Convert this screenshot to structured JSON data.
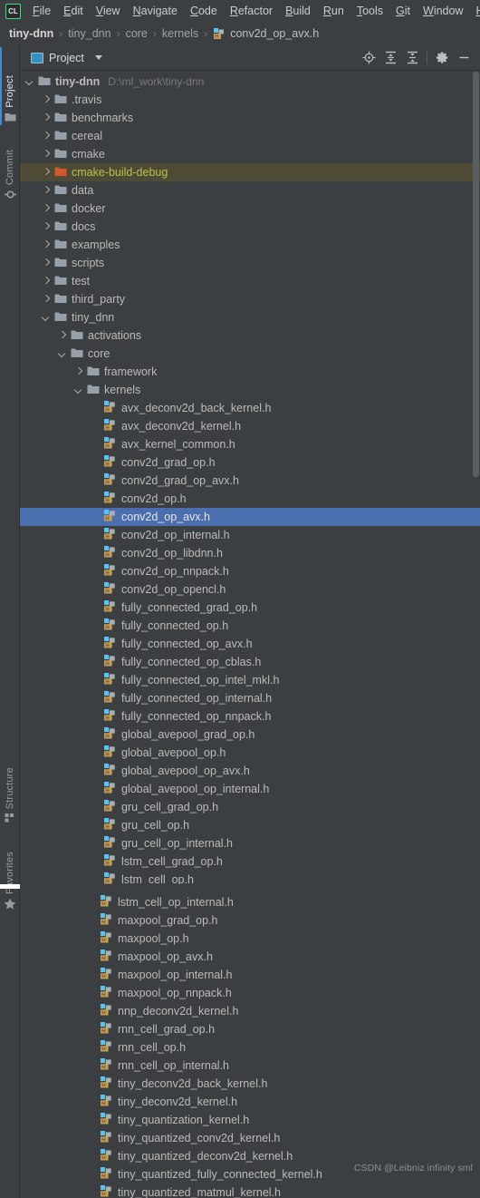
{
  "app": {
    "logo_text": "CL",
    "menu": [
      {
        "label": "File",
        "mnemonic": "F"
      },
      {
        "label": "Edit",
        "mnemonic": "E"
      },
      {
        "label": "View",
        "mnemonic": "V"
      },
      {
        "label": "Navigate",
        "mnemonic": "N"
      },
      {
        "label": "Code",
        "mnemonic": "C"
      },
      {
        "label": "Refactor",
        "mnemonic": "R"
      },
      {
        "label": "Build",
        "mnemonic": "B"
      },
      {
        "label": "Run",
        "mnemonic": "R"
      },
      {
        "label": "Tools",
        "mnemonic": "T"
      },
      {
        "label": "Git",
        "mnemonic": "G"
      },
      {
        "label": "Window",
        "mnemonic": "W"
      },
      {
        "label": "H",
        "mnemonic": "H"
      }
    ]
  },
  "breadcrumb": {
    "separator": "›",
    "items": [
      "tiny-dnn",
      "tiny_dnn",
      "core",
      "kernels"
    ],
    "file": "conv2d_op_avx.h",
    "file_icon": "header-file-icon"
  },
  "toolstrip": {
    "buttons": [
      {
        "name": "project",
        "label": "Project",
        "icon": "folder-icon",
        "active": true
      },
      {
        "name": "commit",
        "label": "Commit",
        "icon": "commit-icon",
        "active": false
      },
      {
        "name": "structure",
        "label": "Structure",
        "icon": "structure-icon",
        "active": false
      },
      {
        "name": "favorites",
        "label": "Favorites",
        "icon": "star-icon",
        "active": false
      }
    ]
  },
  "panel": {
    "title": "Project",
    "title_icon": "project-view-icon",
    "dropdown_icon": "chevron-down-icon",
    "actions": [
      {
        "name": "select-opened-file",
        "icon": "target-icon",
        "tooltip": "Select Opened File"
      },
      {
        "name": "expand-all",
        "icon": "expand-all-icon",
        "tooltip": "Expand All"
      },
      {
        "name": "collapse-all",
        "icon": "collapse-all-icon",
        "tooltip": "Collapse All"
      },
      {
        "name": "settings",
        "icon": "gear-icon",
        "tooltip": "Settings"
      },
      {
        "name": "hide",
        "icon": "minimize-icon",
        "tooltip": "Hide"
      }
    ]
  },
  "colors": {
    "background": "#3C3F41",
    "selection": "#4B6EAF",
    "excluded_row_bg": "#4E4A35",
    "excluded_text": "#B5C44A",
    "text": "#BBBBBB",
    "muted_text": "#78797A",
    "folder": "#97A0A8",
    "folder_excluded": "#D2572A",
    "header_icon_blue": "#56C6F0",
    "header_icon_orange": "#C9A050"
  },
  "tree": {
    "rows": [
      {
        "depth": 0,
        "arrow": "open",
        "icon": "folder-icon",
        "label": "tiny-dnn",
        "sub": "D:\\ml_work\\tiny-dnn",
        "state": "normal"
      },
      {
        "depth": 1,
        "arrow": "closed",
        "icon": "folder-icon",
        "label": ".travis",
        "sub": "",
        "state": "normal"
      },
      {
        "depth": 1,
        "arrow": "closed",
        "icon": "folder-icon",
        "label": "benchmarks",
        "sub": "",
        "state": "normal"
      },
      {
        "depth": 1,
        "arrow": "closed",
        "icon": "folder-icon",
        "label": "cereal",
        "sub": "",
        "state": "normal"
      },
      {
        "depth": 1,
        "arrow": "closed",
        "icon": "folder-icon",
        "label": "cmake",
        "sub": "",
        "state": "normal"
      },
      {
        "depth": 1,
        "arrow": "closed",
        "icon": "folder-excluded-icon",
        "label": "cmake-build-debug",
        "sub": "",
        "state": "excluded"
      },
      {
        "depth": 1,
        "arrow": "closed",
        "icon": "folder-icon",
        "label": "data",
        "sub": "",
        "state": "normal"
      },
      {
        "depth": 1,
        "arrow": "closed",
        "icon": "folder-icon",
        "label": "docker",
        "sub": "",
        "state": "normal"
      },
      {
        "depth": 1,
        "arrow": "closed",
        "icon": "folder-icon",
        "label": "docs",
        "sub": "",
        "state": "normal"
      },
      {
        "depth": 1,
        "arrow": "closed",
        "icon": "folder-icon",
        "label": "examples",
        "sub": "",
        "state": "normal"
      },
      {
        "depth": 1,
        "arrow": "closed",
        "icon": "folder-icon",
        "label": "scripts",
        "sub": "",
        "state": "normal"
      },
      {
        "depth": 1,
        "arrow": "closed",
        "icon": "folder-icon",
        "label": "test",
        "sub": "",
        "state": "normal"
      },
      {
        "depth": 1,
        "arrow": "closed",
        "icon": "folder-icon",
        "label": "third_party",
        "sub": "",
        "state": "normal"
      },
      {
        "depth": 1,
        "arrow": "open",
        "icon": "folder-icon",
        "label": "tiny_dnn",
        "sub": "",
        "state": "normal"
      },
      {
        "depth": 2,
        "arrow": "closed",
        "icon": "folder-icon",
        "label": "activations",
        "sub": "",
        "state": "normal"
      },
      {
        "depth": 2,
        "arrow": "open",
        "icon": "folder-icon",
        "label": "core",
        "sub": "",
        "state": "normal"
      },
      {
        "depth": 3,
        "arrow": "closed",
        "icon": "folder-icon",
        "label": "framework",
        "sub": "",
        "state": "normal"
      },
      {
        "depth": 3,
        "arrow": "open",
        "icon": "folder-icon",
        "label": "kernels",
        "sub": "",
        "state": "normal"
      },
      {
        "depth": 4,
        "arrow": "none",
        "icon": "header-file-icon",
        "label": "avx_deconv2d_back_kernel.h",
        "sub": "",
        "state": "normal"
      },
      {
        "depth": 4,
        "arrow": "none",
        "icon": "header-file-icon",
        "label": "avx_deconv2d_kernel.h",
        "sub": "",
        "state": "normal"
      },
      {
        "depth": 4,
        "arrow": "none",
        "icon": "header-file-icon",
        "label": "avx_kernel_common.h",
        "sub": "",
        "state": "normal"
      },
      {
        "depth": 4,
        "arrow": "none",
        "icon": "header-file-icon",
        "label": "conv2d_grad_op.h",
        "sub": "",
        "state": "normal"
      },
      {
        "depth": 4,
        "arrow": "none",
        "icon": "header-file-icon",
        "label": "conv2d_grad_op_avx.h",
        "sub": "",
        "state": "normal"
      },
      {
        "depth": 4,
        "arrow": "none",
        "icon": "header-file-icon",
        "label": "conv2d_op.h",
        "sub": "",
        "state": "normal"
      },
      {
        "depth": 4,
        "arrow": "none",
        "icon": "header-file-icon",
        "label": "conv2d_op_avx.h",
        "sub": "",
        "state": "selected"
      },
      {
        "depth": 4,
        "arrow": "none",
        "icon": "header-file-icon",
        "label": "conv2d_op_internal.h",
        "sub": "",
        "state": "normal"
      },
      {
        "depth": 4,
        "arrow": "none",
        "icon": "header-file-icon",
        "label": "conv2d_op_libdnn.h",
        "sub": "",
        "state": "normal"
      },
      {
        "depth": 4,
        "arrow": "none",
        "icon": "header-file-icon",
        "label": "conv2d_op_nnpack.h",
        "sub": "",
        "state": "normal"
      },
      {
        "depth": 4,
        "arrow": "none",
        "icon": "header-file-icon",
        "label": "conv2d_op_opencl.h",
        "sub": "",
        "state": "normal"
      },
      {
        "depth": 4,
        "arrow": "none",
        "icon": "header-file-icon",
        "label": "fully_connected_grad_op.h",
        "sub": "",
        "state": "normal"
      },
      {
        "depth": 4,
        "arrow": "none",
        "icon": "header-file-icon",
        "label": "fully_connected_op.h",
        "sub": "",
        "state": "normal"
      },
      {
        "depth": 4,
        "arrow": "none",
        "icon": "header-file-icon",
        "label": "fully_connected_op_avx.h",
        "sub": "",
        "state": "normal"
      },
      {
        "depth": 4,
        "arrow": "none",
        "icon": "header-file-icon",
        "label": "fully_connected_op_cblas.h",
        "sub": "",
        "state": "normal"
      },
      {
        "depth": 4,
        "arrow": "none",
        "icon": "header-file-icon",
        "label": "fully_connected_op_intel_mkl.h",
        "sub": "",
        "state": "normal"
      },
      {
        "depth": 4,
        "arrow": "none",
        "icon": "header-file-icon",
        "label": "fully_connected_op_internal.h",
        "sub": "",
        "state": "normal"
      },
      {
        "depth": 4,
        "arrow": "none",
        "icon": "header-file-icon",
        "label": "fully_connected_op_nnpack.h",
        "sub": "",
        "state": "normal"
      },
      {
        "depth": 4,
        "arrow": "none",
        "icon": "header-file-icon",
        "label": "global_avepool_grad_op.h",
        "sub": "",
        "state": "normal"
      },
      {
        "depth": 4,
        "arrow": "none",
        "icon": "header-file-icon",
        "label": "global_avepool_op.h",
        "sub": "",
        "state": "normal"
      },
      {
        "depth": 4,
        "arrow": "none",
        "icon": "header-file-icon",
        "label": "global_avepool_op_avx.h",
        "sub": "",
        "state": "normal"
      },
      {
        "depth": 4,
        "arrow": "none",
        "icon": "header-file-icon",
        "label": "global_avepool_op_internal.h",
        "sub": "",
        "state": "normal"
      },
      {
        "depth": 4,
        "arrow": "none",
        "icon": "header-file-icon",
        "label": "gru_cell_grad_op.h",
        "sub": "",
        "state": "normal"
      },
      {
        "depth": 4,
        "arrow": "none",
        "icon": "header-file-icon",
        "label": "gru_cell_op.h",
        "sub": "",
        "state": "normal"
      },
      {
        "depth": 4,
        "arrow": "none",
        "icon": "header-file-icon",
        "label": "gru_cell_op_internal.h",
        "sub": "",
        "state": "normal"
      },
      {
        "depth": 4,
        "arrow": "none",
        "icon": "header-file-icon",
        "label": "lstm_cell_grad_op.h",
        "sub": "",
        "state": "normal"
      },
      {
        "depth": 4,
        "arrow": "none",
        "icon": "header-file-icon",
        "label": "lstm_cell_op.h",
        "sub": "",
        "state": "normal"
      },
      {
        "depth": 4,
        "arrow": "none",
        "icon": "header-file-icon",
        "label": "lstm_cell_op_internal.h",
        "sub": "",
        "state": "normal"
      },
      {
        "depth": 4,
        "arrow": "none",
        "icon": "header-file-icon",
        "label": "maxpool_grad_op.h",
        "sub": "",
        "state": "normal"
      },
      {
        "depth": 4,
        "arrow": "none",
        "icon": "header-file-icon",
        "label": "maxpool_op.h",
        "sub": "",
        "state": "normal"
      },
      {
        "depth": 4,
        "arrow": "none",
        "icon": "header-file-icon",
        "label": "maxpool_op_avx.h",
        "sub": "",
        "state": "normal"
      },
      {
        "depth": 4,
        "arrow": "none",
        "icon": "header-file-icon",
        "label": "maxpool_op_internal.h",
        "sub": "",
        "state": "normal"
      },
      {
        "depth": 4,
        "arrow": "none",
        "icon": "header-file-icon",
        "label": "maxpool_op_nnpack.h",
        "sub": "",
        "state": "normal"
      },
      {
        "depth": 4,
        "arrow": "none",
        "icon": "header-file-icon",
        "label": "nnp_deconv2d_kernel.h",
        "sub": "",
        "state": "normal"
      },
      {
        "depth": 4,
        "arrow": "none",
        "icon": "header-file-icon",
        "label": "rnn_cell_grad_op.h",
        "sub": "",
        "state": "normal"
      },
      {
        "depth": 4,
        "arrow": "none",
        "icon": "header-file-icon",
        "label": "rnn_cell_op.h",
        "sub": "",
        "state": "normal"
      },
      {
        "depth": 4,
        "arrow": "none",
        "icon": "header-file-icon",
        "label": "rnn_cell_op_internal.h",
        "sub": "",
        "state": "normal"
      },
      {
        "depth": 4,
        "arrow": "none",
        "icon": "header-file-icon",
        "label": "tiny_deconv2d_back_kernel.h",
        "sub": "",
        "state": "normal"
      },
      {
        "depth": 4,
        "arrow": "none",
        "icon": "header-file-icon",
        "label": "tiny_deconv2d_kernel.h",
        "sub": "",
        "state": "normal"
      },
      {
        "depth": 4,
        "arrow": "none",
        "icon": "header-file-icon",
        "label": "tiny_quantization_kernel.h",
        "sub": "",
        "state": "normal"
      },
      {
        "depth": 4,
        "arrow": "none",
        "icon": "header-file-icon",
        "label": "tiny_quantized_conv2d_kernel.h",
        "sub": "",
        "state": "normal"
      },
      {
        "depth": 4,
        "arrow": "none",
        "icon": "header-file-icon",
        "label": "tiny_quantized_deconv2d_kernel.h",
        "sub": "",
        "state": "normal"
      },
      {
        "depth": 4,
        "arrow": "none",
        "icon": "header-file-icon",
        "label": "tiny_quantized_fully_connected_kernel.h",
        "sub": "",
        "state": "normal"
      },
      {
        "depth": 4,
        "arrow": "none",
        "icon": "header-file-icon",
        "label": "tiny_quantized_matmul_kernel.h",
        "sub": "",
        "state": "normal"
      }
    ]
  },
  "watermark": "CSDN @Leibniz infinity sml"
}
